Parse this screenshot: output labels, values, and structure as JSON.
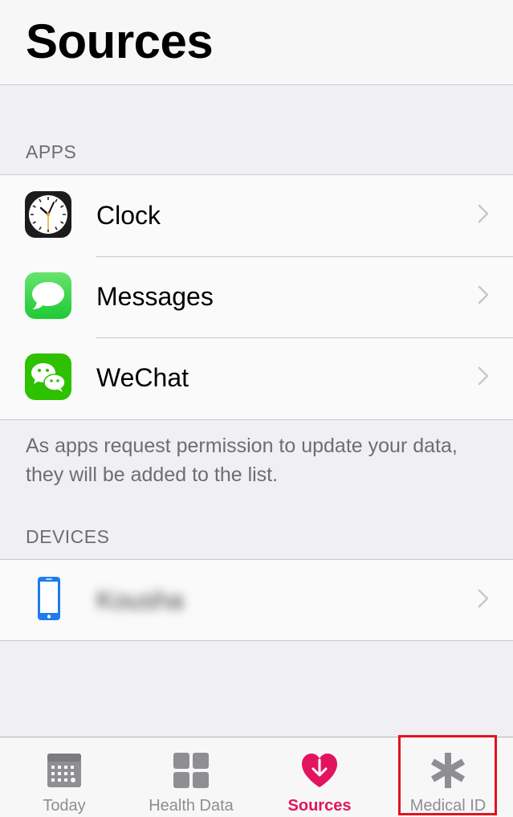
{
  "header": {
    "title": "Sources"
  },
  "apps_section": {
    "title": "APPS",
    "items": [
      {
        "label": "Clock",
        "icon": "clock-icon"
      },
      {
        "label": "Messages",
        "icon": "messages-icon"
      },
      {
        "label": "WeChat",
        "icon": "wechat-icon"
      }
    ],
    "note": "As apps request permission to update your data, they will be added to the list."
  },
  "devices_section": {
    "title": "DEVICES",
    "items": [
      {
        "label": "Kousha",
        "icon": "iphone-icon",
        "blurred": true
      }
    ]
  },
  "tabbar": {
    "tabs": [
      {
        "label": "Today",
        "icon": "calendar-icon",
        "active": false
      },
      {
        "label": "Health Data",
        "icon": "grid-icon",
        "active": false
      },
      {
        "label": "Sources",
        "icon": "heart-download-icon",
        "active": true
      },
      {
        "label": "Medical ID",
        "icon": "asterisk-icon",
        "active": false,
        "highlighted": true
      }
    ]
  },
  "colors": {
    "accent": "#e3145e",
    "highlight_border": "#e0131f",
    "background": "#efeff4",
    "secondary_text": "#6d6d72"
  }
}
